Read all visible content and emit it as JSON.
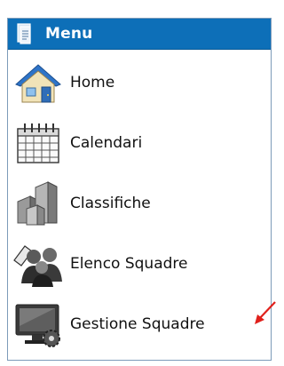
{
  "menu": {
    "title": "Menu",
    "items": [
      {
        "label": "Home",
        "icon": "home-icon"
      },
      {
        "label": "Calendari",
        "icon": "calendar-icon"
      },
      {
        "label": "Classifiche",
        "icon": "standings-icon"
      },
      {
        "label": "Elenco Squadre",
        "icon": "teams-icon"
      },
      {
        "label": "Gestione Squadre",
        "icon": "team-management-icon"
      }
    ]
  },
  "colors": {
    "header_bg": "#0d6fb8",
    "border": "#7d9bb9",
    "annotation_arrow": "#e0201b"
  }
}
